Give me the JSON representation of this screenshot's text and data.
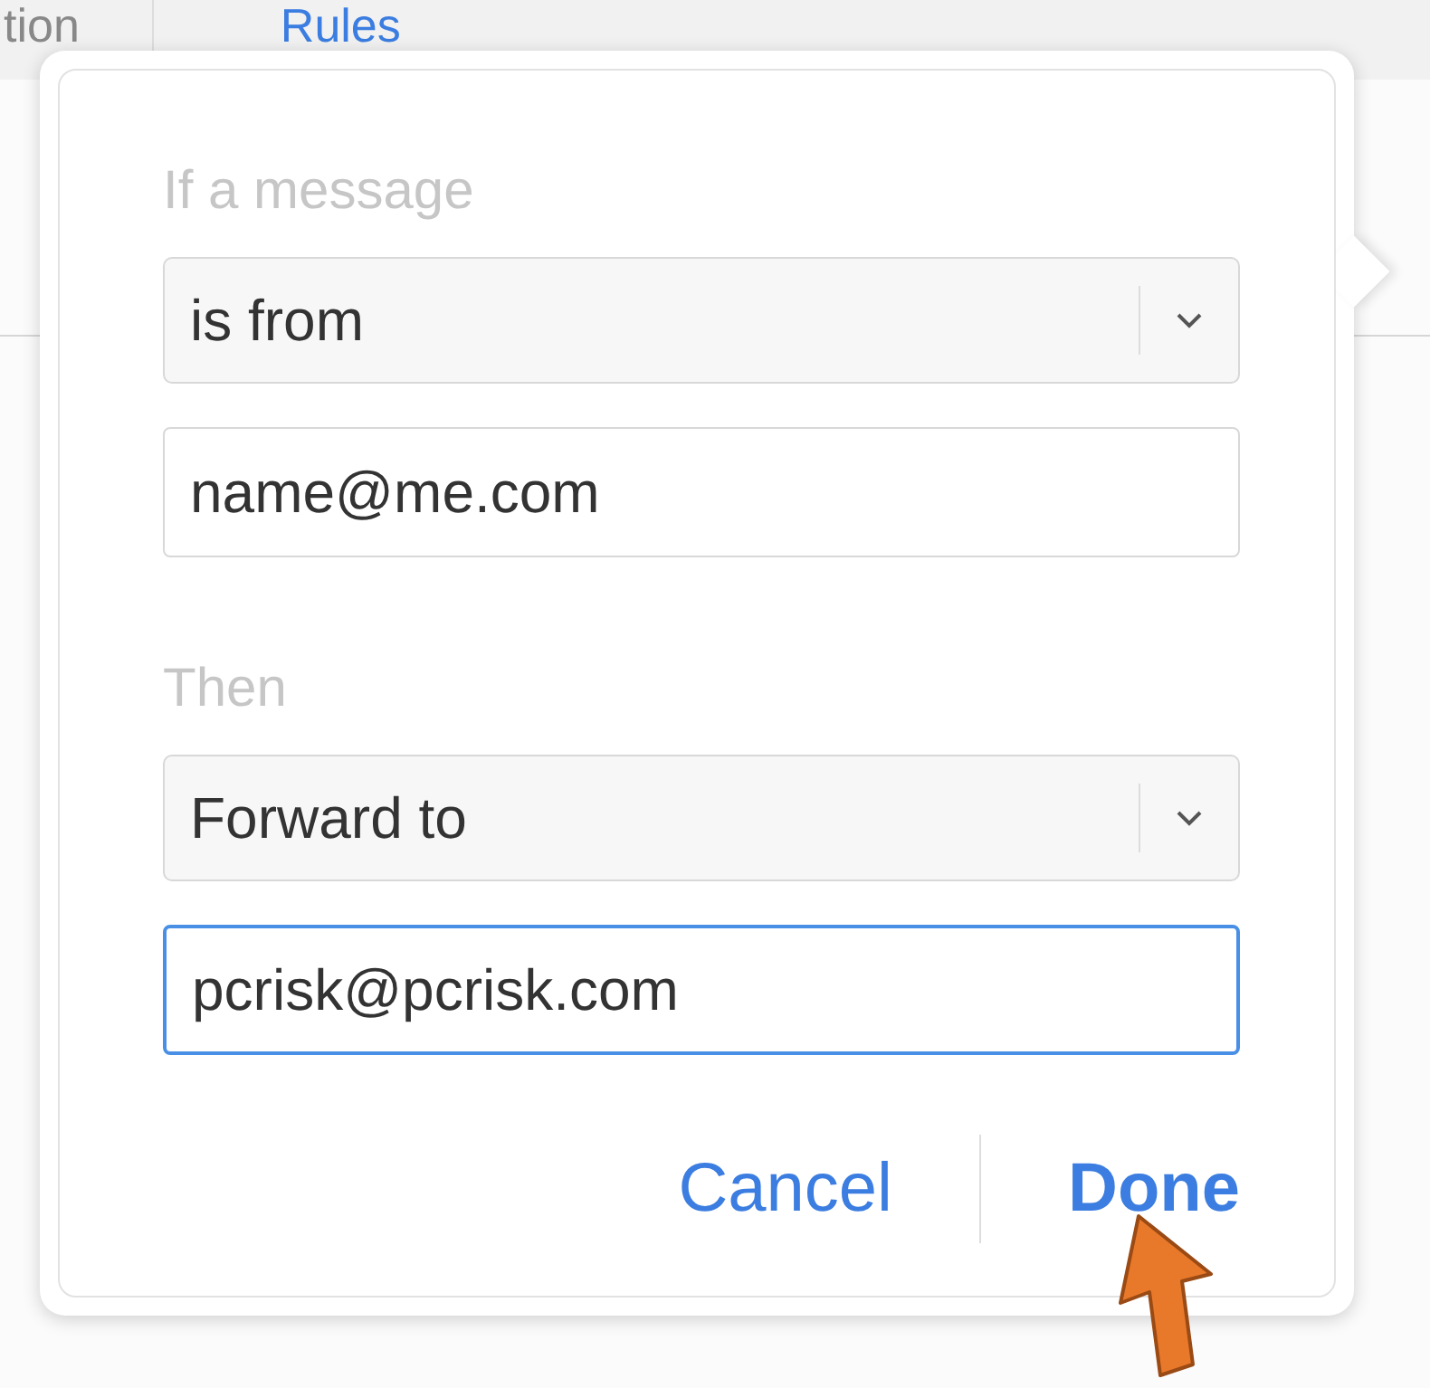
{
  "tabs": [
    {
      "label": "tion",
      "selected": false
    },
    {
      "label": "Rules",
      "selected": true
    }
  ],
  "rule_popover": {
    "condition_label": "If a message",
    "condition_select": {
      "value": "is from"
    },
    "condition_field": {
      "value": "name@me.com",
      "focused": false
    },
    "action_label": "Then",
    "action_select": {
      "value": "Forward to"
    },
    "action_field": {
      "value": "pcrisk@pcrisk.com",
      "focused": true
    },
    "buttons": [
      {
        "label": "Cancel",
        "kind": "secondary"
      },
      {
        "label": "Done",
        "kind": "primary"
      }
    ]
  }
}
